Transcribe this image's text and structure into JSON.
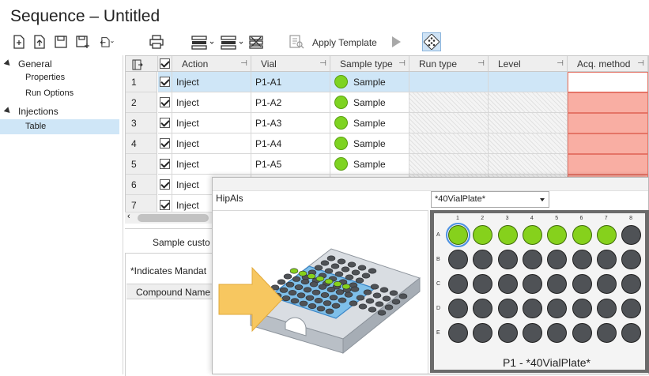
{
  "window": {
    "title": "Sequence – Untitled"
  },
  "toolbar": {
    "apply_template_label": "Apply Template",
    "icons": [
      "new-file-icon",
      "open-file-icon",
      "save-icon",
      "save-as-icon",
      "import-icon",
      "print-icon",
      "insert-row-icon",
      "append-row-icon",
      "delete-row-icon",
      "template-icon",
      "run-icon",
      "plate-icon"
    ]
  },
  "sidebar": {
    "groups": [
      {
        "label": "General",
        "items": [
          "Properties",
          "Run Options"
        ]
      },
      {
        "label": "Injections",
        "items": [
          "Table"
        ]
      }
    ],
    "selected": "Table"
  },
  "grid": {
    "columns": [
      "Action",
      "Vial",
      "Sample type",
      "Run type",
      "Level",
      "Acq. method"
    ],
    "rows": [
      {
        "num": "1",
        "checked": true,
        "action": "Inject",
        "vial": "P1-A1",
        "sample_type": "Sample"
      },
      {
        "num": "2",
        "checked": true,
        "action": "Inject",
        "vial": "P1-A2",
        "sample_type": "Sample"
      },
      {
        "num": "3",
        "checked": true,
        "action": "Inject",
        "vial": "P1-A3",
        "sample_type": "Sample"
      },
      {
        "num": "4",
        "checked": true,
        "action": "Inject",
        "vial": "P1-A4",
        "sample_type": "Sample"
      },
      {
        "num": "5",
        "checked": true,
        "action": "Inject",
        "vial": "P1-A5",
        "sample_type": "Sample"
      },
      {
        "num": "6",
        "checked": true,
        "action": "Inject",
        "vial": "",
        "sample_type": ""
      },
      {
        "num": "7",
        "checked": true,
        "action": "Inject",
        "vial": "",
        "sample_type": ""
      }
    ],
    "colors": {
      "selected_row": "#cfe6f7",
      "error_cell": "#f9aea3",
      "sample_dot": "#7ed321"
    }
  },
  "lower_panel": {
    "sample_custom": "Sample custo",
    "mandatory_note": "*Indicates Mandat",
    "compound_name": "Compound Name"
  },
  "popup": {
    "sampler": "HipAls",
    "plate_select": "*40VialPlate*",
    "plate_title": "P1 - *40VialPlate*",
    "columns": [
      "1",
      "2",
      "3",
      "4",
      "5",
      "6",
      "7",
      "8"
    ],
    "rows": [
      "A",
      "B",
      "C",
      "D",
      "E"
    ],
    "occupied_wells": [
      "A1",
      "A2",
      "A3",
      "A4",
      "A5",
      "A6",
      "A7"
    ],
    "highlighted_well": "A1"
  }
}
